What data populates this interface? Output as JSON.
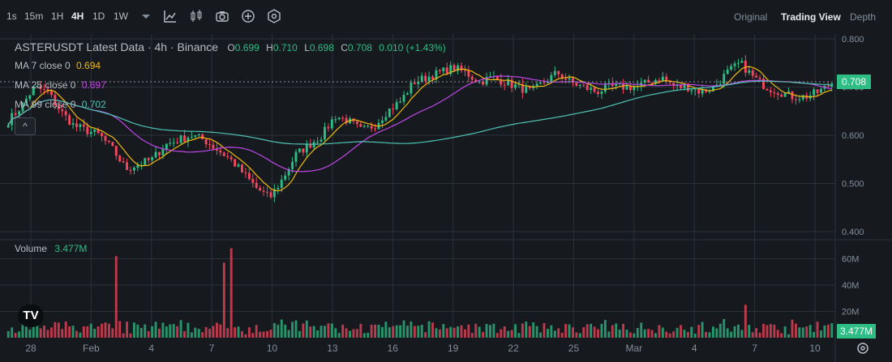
{
  "toolbar": {
    "intervals": [
      "1s",
      "15m",
      "1H",
      "4H",
      "1D",
      "1W"
    ],
    "active_interval": "4H",
    "icons": [
      "chevron-down-icon",
      "chart-type-icon",
      "candlestick-icon",
      "camera-icon",
      "plus-circle-icon",
      "settings-hex-icon"
    ],
    "views": [
      "Original",
      "Trading View",
      "Depth"
    ],
    "active_view": "Trading View"
  },
  "legend": {
    "title": "ASTERUSDT Latest Data · 4h · Binance",
    "open_k": "O",
    "open": "0.699",
    "high_k": "H",
    "high": "0.710",
    "low_k": "L",
    "low": "0.698",
    "close_k": "C",
    "close": "0.708",
    "change": "0.010 (+1.43%)",
    "ma7_label": "MA 7 close 0",
    "ma7_value": "0.694",
    "ma25_label": "MA 25 close 0",
    "ma25_value": "0.697",
    "ma99_label": "MA 99 close 0",
    "ma99_value": "0.702",
    "collapse": "^"
  },
  "volume_legend": {
    "label": "Volume",
    "value": "3.477M"
  },
  "price_tag": "0.708",
  "volume_tag": "3.477M",
  "logo": "TV",
  "colors": {
    "up": "#2ebd85",
    "down": "#f6465d",
    "ma7": "#f0b90b",
    "ma25": "#c147e9",
    "ma99": "#4fc3b4",
    "bg": "#161a1e",
    "grid": "#2b3139"
  },
  "chart_data": {
    "type": "candlestick",
    "symbol": "ASTERUSDT",
    "interval": "4h",
    "price_axis": {
      "ticks": [
        "0.800",
        "0.700",
        "0.600",
        "0.500",
        "0.400"
      ],
      "range": [
        0.39,
        0.81
      ]
    },
    "volume_axis": {
      "ticks": [
        "60M",
        "40M",
        "20M"
      ],
      "range": [
        0,
        72
      ]
    },
    "x_ticks": [
      "28",
      "Feb",
      "4",
      "7",
      "10",
      "13",
      "16",
      "19",
      "22",
      "25",
      "Mar",
      "4",
      "7",
      "10"
    ],
    "close_path": [
      0.63,
      0.66,
      0.7,
      0.69,
      0.65,
      0.62,
      0.61,
      0.6,
      0.57,
      0.53,
      0.54,
      0.55,
      0.58,
      0.59,
      0.6,
      0.59,
      0.57,
      0.55,
      0.52,
      0.49,
      0.47,
      0.51,
      0.56,
      0.58,
      0.6,
      0.64,
      0.63,
      0.61,
      0.62,
      0.65,
      0.67,
      0.71,
      0.72,
      0.73,
      0.74,
      0.73,
      0.71,
      0.72,
      0.71,
      0.7,
      0.69,
      0.71,
      0.73,
      0.71,
      0.7,
      0.69,
      0.7,
      0.7,
      0.7,
      0.71,
      0.72,
      0.7,
      0.7,
      0.69,
      0.7,
      0.73,
      0.75,
      0.72,
      0.7,
      0.69,
      0.68,
      0.68,
      0.69,
      0.708
    ],
    "volume_peaks": [
      {
        "x": "Feb",
        "value": 62
      },
      {
        "x": "6",
        "value": 57
      },
      {
        "x": "6",
        "value": 68
      },
      {
        "x": "3",
        "value": 25
      }
    ],
    "ma7_last": 0.694,
    "ma25_last": 0.697,
    "ma99_last": 0.702,
    "last_price": 0.708,
    "last_volume": "3.477M"
  }
}
